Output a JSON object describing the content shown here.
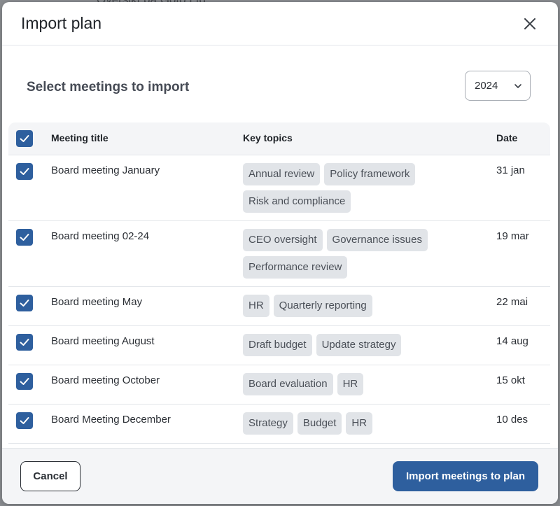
{
  "backdrop": {
    "text": "Oversikt på Goto Ltd"
  },
  "modal": {
    "title": "Import plan",
    "close_icon": "close-icon"
  },
  "section": {
    "title": "Select meetings to import",
    "year": "2024"
  },
  "table": {
    "columns": {
      "title": "Meeting title",
      "topics": "Key topics",
      "date": "Date"
    },
    "select_all_checked": true,
    "rows": [
      {
        "checked": true,
        "title": "Board meeting January",
        "topics": [
          "Annual review",
          "Policy framework",
          "Risk and compliance"
        ],
        "date": "31 jan"
      },
      {
        "checked": true,
        "title": "Board meeting 02-24",
        "topics": [
          "CEO oversight",
          "Governance issues",
          "Performance review"
        ],
        "date": "19 mar"
      },
      {
        "checked": true,
        "title": "Board meeting May",
        "topics": [
          "HR",
          "Quarterly reporting"
        ],
        "date": "22 mai"
      },
      {
        "checked": true,
        "title": "Board meeting August",
        "topics": [
          "Draft budget",
          "Update strategy"
        ],
        "date": "14 aug"
      },
      {
        "checked": true,
        "title": "Board meeting October",
        "topics": [
          "Board evaluation",
          "HR"
        ],
        "date": "15 okt"
      },
      {
        "checked": true,
        "title": "Board Meeting December",
        "topics": [
          "Strategy",
          "Budget",
          "HR"
        ],
        "date": "10 des"
      }
    ]
  },
  "footer": {
    "cancel_label": "Cancel",
    "import_label": "Import meetings to plan"
  },
  "colors": {
    "accent": "#2e5f9e",
    "tag_bg": "#e1e4e8",
    "footer_bg": "#f4f5f7"
  }
}
